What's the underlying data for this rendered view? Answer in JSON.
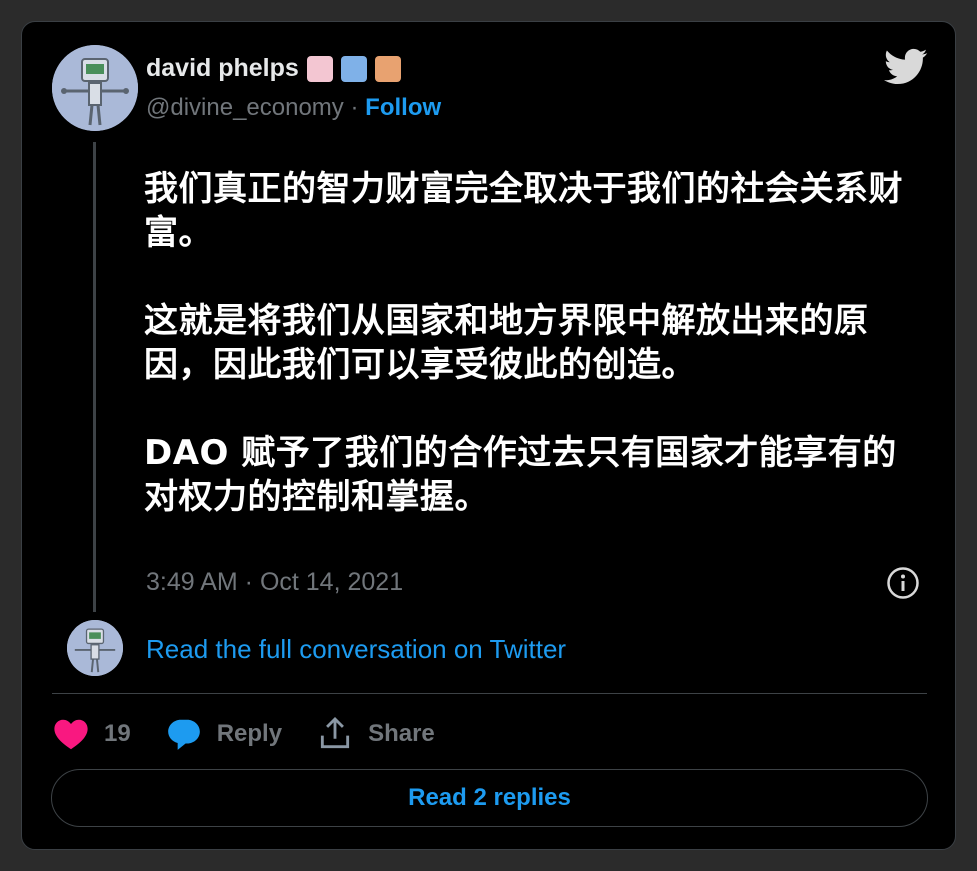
{
  "author": {
    "name": "david phelps",
    "handle": "@divine_economy",
    "separator": "·",
    "follow_label": "Follow"
  },
  "tweet": {
    "paragraphs": [
      "我们真正的智力财富完全取决于我们的社会关系财富。",
      "这就是将我们从国家和地方界限中解放出来的原因，因此我们可以享受彼此的创造。",
      "DAO  赋予了我们的合作过去只有国家才能享有的对权力的控制和掌握。"
    ],
    "timestamp": "3:49 AM · Oct 14, 2021"
  },
  "read_conversation_label": "Read the full conversation on Twitter",
  "actions": {
    "like_count": "19",
    "reply_label": "Reply",
    "share_label": "Share"
  },
  "read_replies_label": "Read 2 replies",
  "colors": {
    "accent": "#1d9bf0",
    "like": "#f91880",
    "muted": "#71767b",
    "background": "#000000"
  },
  "icons": [
    "robot-avatar-icon",
    "cow-emoji-icon",
    "castle-emoji-icon",
    "figure-emoji-icon",
    "twitter-bird-icon",
    "info-icon",
    "heart-icon",
    "reply-bubble-icon",
    "share-icon"
  ]
}
